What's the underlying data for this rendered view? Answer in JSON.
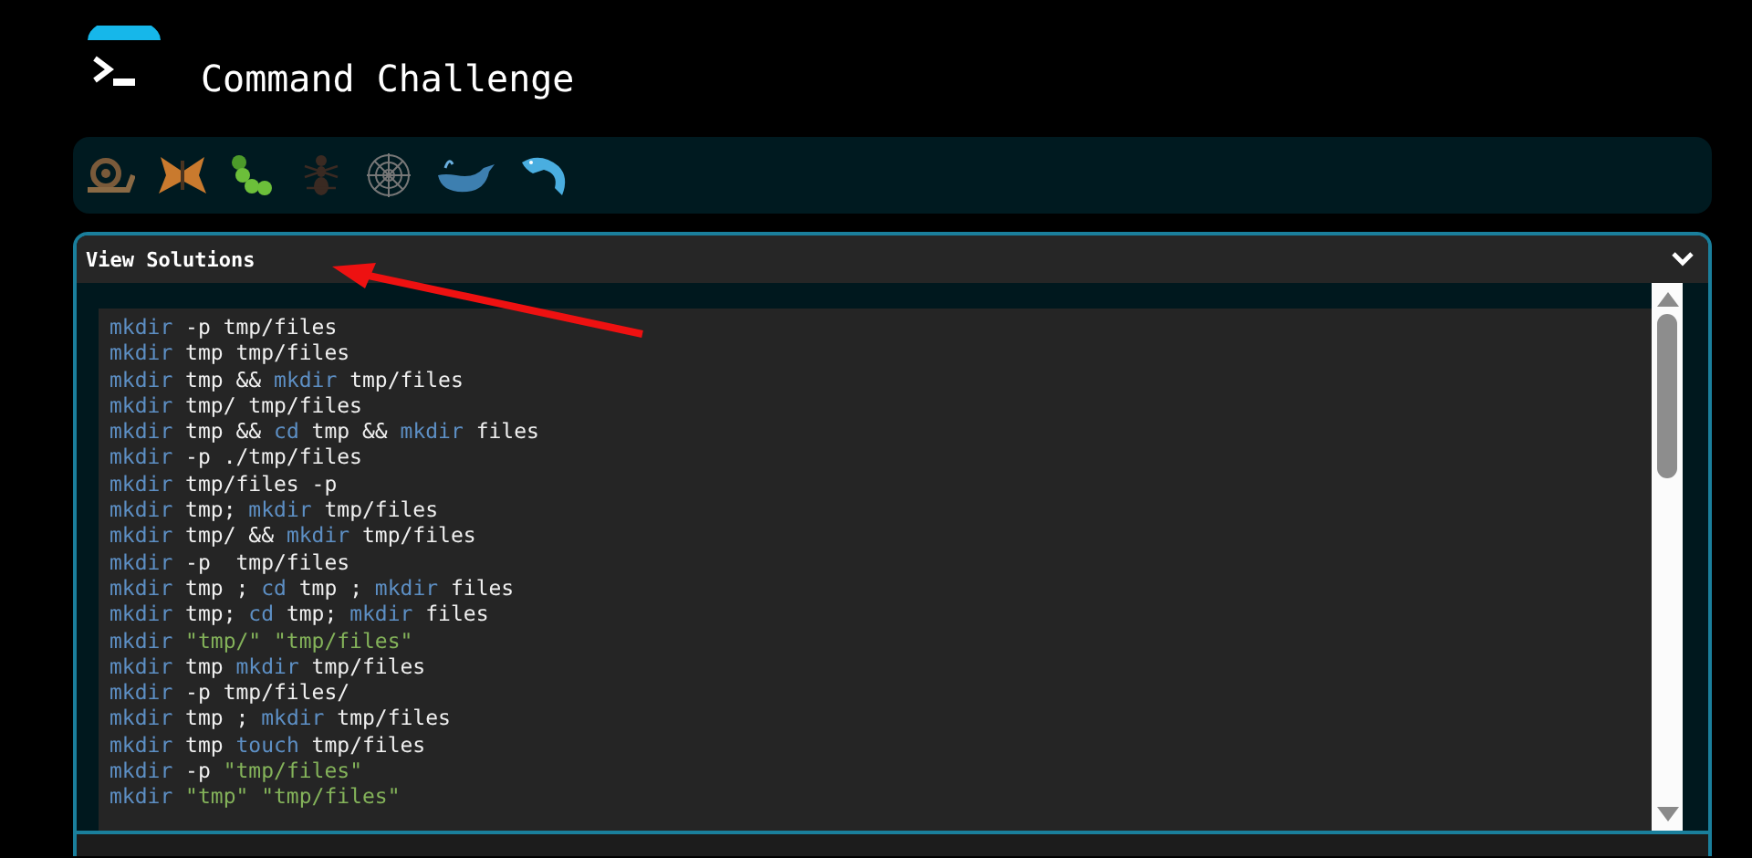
{
  "header": {
    "title": "Command Challenge"
  },
  "panel": {
    "title": "View Solutions",
    "expanded": true
  },
  "solutions": [
    {
      "tokens": [
        {
          "kind": "cmd",
          "text": "mkdir"
        },
        {
          "kind": "arg",
          "text": " -p tmp/files"
        }
      ]
    },
    {
      "tokens": [
        {
          "kind": "cmd",
          "text": "mkdir"
        },
        {
          "kind": "arg",
          "text": " tmp tmp/files"
        }
      ]
    },
    {
      "tokens": [
        {
          "kind": "cmd",
          "text": "mkdir"
        },
        {
          "kind": "arg",
          "text": " tmp && "
        },
        {
          "kind": "cmd",
          "text": "mkdir"
        },
        {
          "kind": "arg",
          "text": " tmp/files"
        }
      ]
    },
    {
      "tokens": [
        {
          "kind": "cmd",
          "text": "mkdir"
        },
        {
          "kind": "arg",
          "text": " tmp/ tmp/files"
        }
      ]
    },
    {
      "tokens": [
        {
          "kind": "cmd",
          "text": "mkdir"
        },
        {
          "kind": "arg",
          "text": " tmp && "
        },
        {
          "kind": "cmd",
          "text": "cd"
        },
        {
          "kind": "arg",
          "text": " tmp && "
        },
        {
          "kind": "cmd",
          "text": "mkdir"
        },
        {
          "kind": "arg",
          "text": " files"
        }
      ]
    },
    {
      "tokens": [
        {
          "kind": "cmd",
          "text": "mkdir"
        },
        {
          "kind": "arg",
          "text": " -p ./tmp/files"
        }
      ]
    },
    {
      "tokens": [
        {
          "kind": "cmd",
          "text": "mkdir"
        },
        {
          "kind": "arg",
          "text": " tmp/files -p"
        }
      ]
    },
    {
      "tokens": [
        {
          "kind": "cmd",
          "text": "mkdir"
        },
        {
          "kind": "arg",
          "text": " tmp; "
        },
        {
          "kind": "cmd",
          "text": "mkdir"
        },
        {
          "kind": "arg",
          "text": " tmp/files"
        }
      ]
    },
    {
      "tokens": [
        {
          "kind": "cmd",
          "text": "mkdir"
        },
        {
          "kind": "arg",
          "text": " tmp/ && "
        },
        {
          "kind": "cmd",
          "text": "mkdir"
        },
        {
          "kind": "arg",
          "text": " tmp/files"
        }
      ]
    },
    {
      "tokens": [
        {
          "kind": "cmd",
          "text": "mkdir"
        },
        {
          "kind": "arg",
          "text": " -p  tmp/files"
        }
      ]
    },
    {
      "tokens": [
        {
          "kind": "cmd",
          "text": "mkdir"
        },
        {
          "kind": "arg",
          "text": " tmp ; "
        },
        {
          "kind": "cmd",
          "text": "cd"
        },
        {
          "kind": "arg",
          "text": " tmp ; "
        },
        {
          "kind": "cmd",
          "text": "mkdir"
        },
        {
          "kind": "arg",
          "text": " files"
        }
      ]
    },
    {
      "tokens": [
        {
          "kind": "cmd",
          "text": "mkdir"
        },
        {
          "kind": "arg",
          "text": " tmp; "
        },
        {
          "kind": "cmd",
          "text": "cd"
        },
        {
          "kind": "arg",
          "text": " tmp; "
        },
        {
          "kind": "cmd",
          "text": "mkdir"
        },
        {
          "kind": "arg",
          "text": " files"
        }
      ]
    },
    {
      "tokens": [
        {
          "kind": "cmd",
          "text": "mkdir"
        },
        {
          "kind": "string",
          "text": " \"tmp/\" \"tmp/files\""
        }
      ]
    },
    {
      "tokens": [
        {
          "kind": "cmd",
          "text": "mkdir"
        },
        {
          "kind": "arg",
          "text": " tmp "
        },
        {
          "kind": "cmd",
          "text": "mkdir"
        },
        {
          "kind": "arg",
          "text": " tmp/files"
        }
      ]
    },
    {
      "tokens": [
        {
          "kind": "cmd",
          "text": "mkdir"
        },
        {
          "kind": "arg",
          "text": " -p tmp/files/"
        }
      ]
    },
    {
      "tokens": [
        {
          "kind": "cmd",
          "text": "mkdir"
        },
        {
          "kind": "arg",
          "text": " tmp ; "
        },
        {
          "kind": "cmd",
          "text": "mkdir"
        },
        {
          "kind": "arg",
          "text": " tmp/files"
        }
      ]
    },
    {
      "tokens": [
        {
          "kind": "cmd",
          "text": "mkdir"
        },
        {
          "kind": "arg",
          "text": " tmp "
        },
        {
          "kind": "cmd",
          "text": "touch"
        },
        {
          "kind": "arg",
          "text": " tmp/files"
        }
      ]
    },
    {
      "tokens": [
        {
          "kind": "cmd",
          "text": "mkdir"
        },
        {
          "kind": "arg",
          "text": " -p "
        },
        {
          "kind": "string",
          "text": "\"tmp/files\""
        }
      ]
    },
    {
      "tokens": [
        {
          "kind": "cmd",
          "text": "mkdir"
        },
        {
          "kind": "string",
          "text": " \"tmp\" \"tmp/files\""
        }
      ]
    }
  ]
}
